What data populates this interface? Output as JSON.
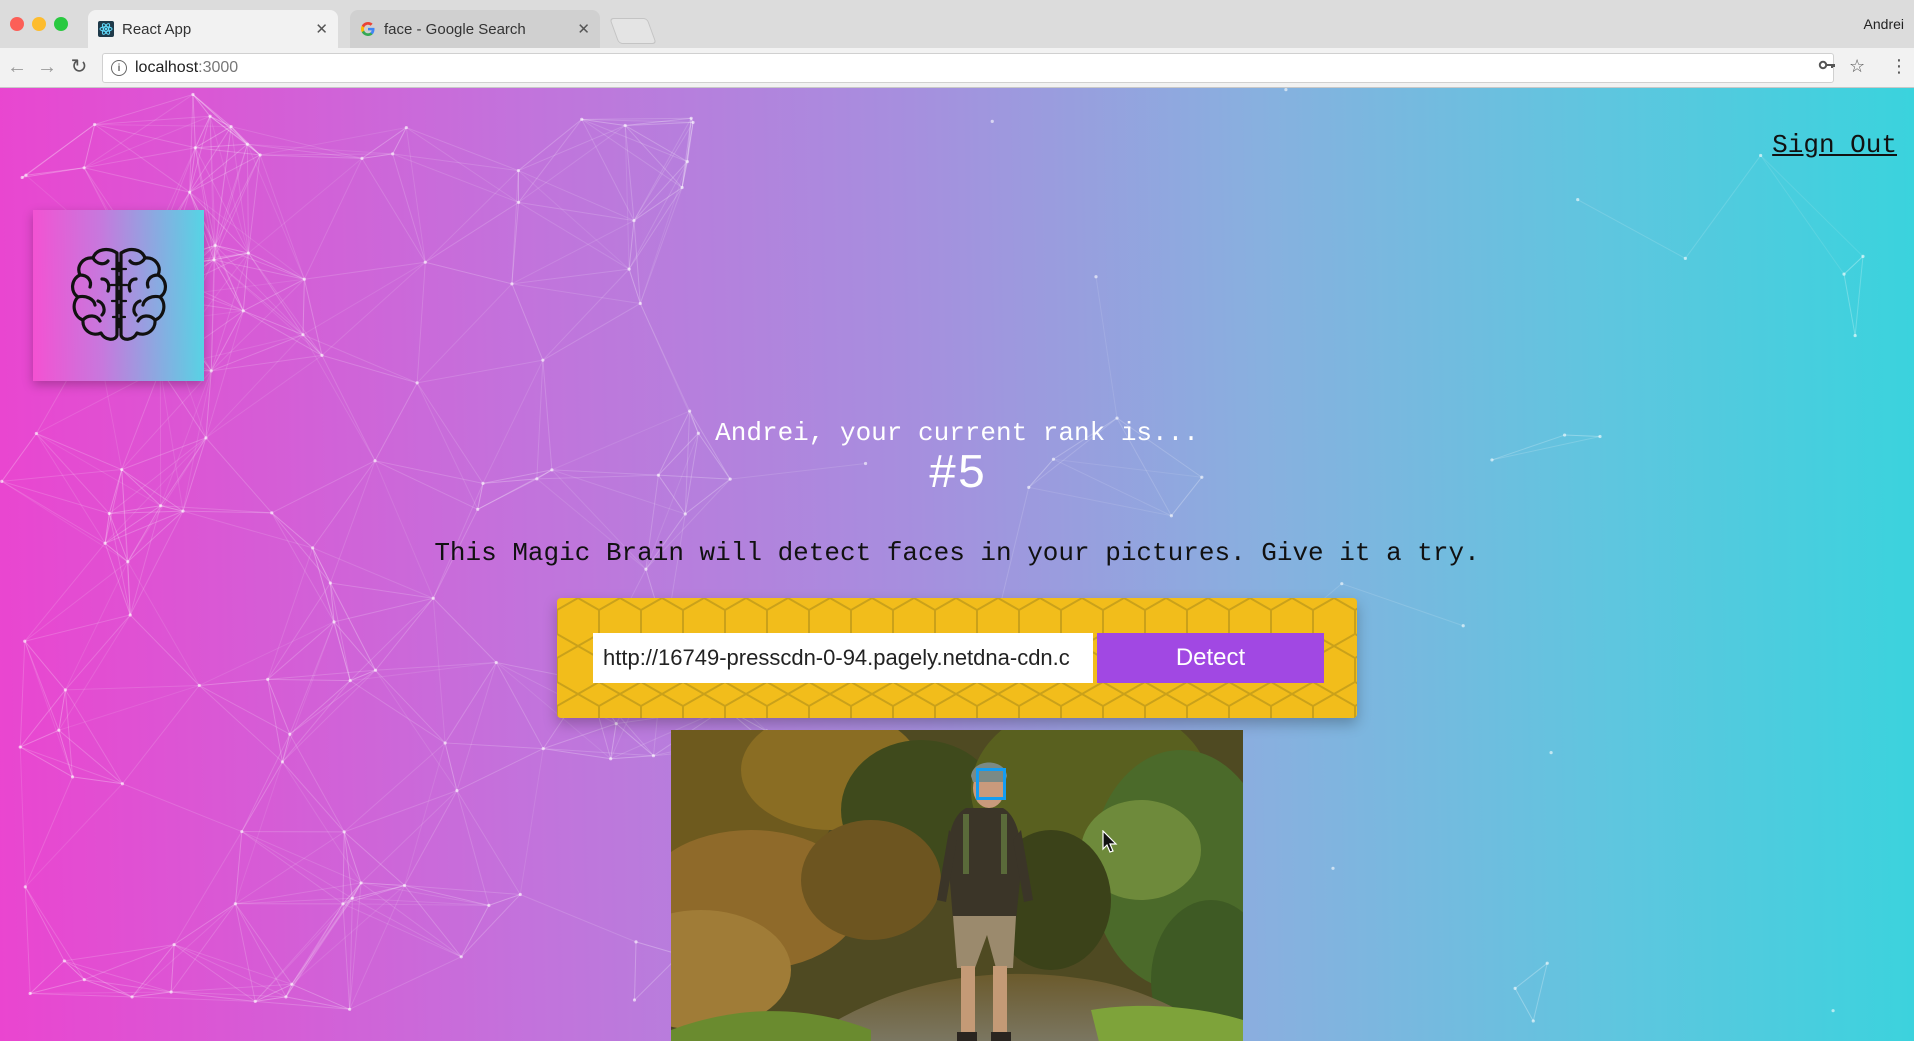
{
  "browser": {
    "tabs": [
      {
        "title": "React App",
        "active": true
      },
      {
        "title": "face - Google Search",
        "active": false
      }
    ],
    "profile_name": "Andrei",
    "url_host": "localhost",
    "url_port": ":3000"
  },
  "app": {
    "sign_out": "Sign Out",
    "rank_intro": "Andrei, your current rank is...",
    "rank_value": "#5",
    "tagline": "This Magic Brain will detect faces in your pictures. Give it a try.",
    "image_url_input": "http://16749-presscdn-0-94.pagely.netdna-cdn.c",
    "detect_label": "Detect"
  },
  "colors": {
    "gradient_left": "#ea45d0",
    "gradient_right": "#3ad3dd",
    "form_background": "#f2bd1b",
    "detect_button": "#a148e3",
    "face_box": "#149df2"
  },
  "icons": {
    "logo": "brain-icon",
    "tab_favicon_react": "react-icon",
    "tab_favicon_google": "google-icon"
  }
}
